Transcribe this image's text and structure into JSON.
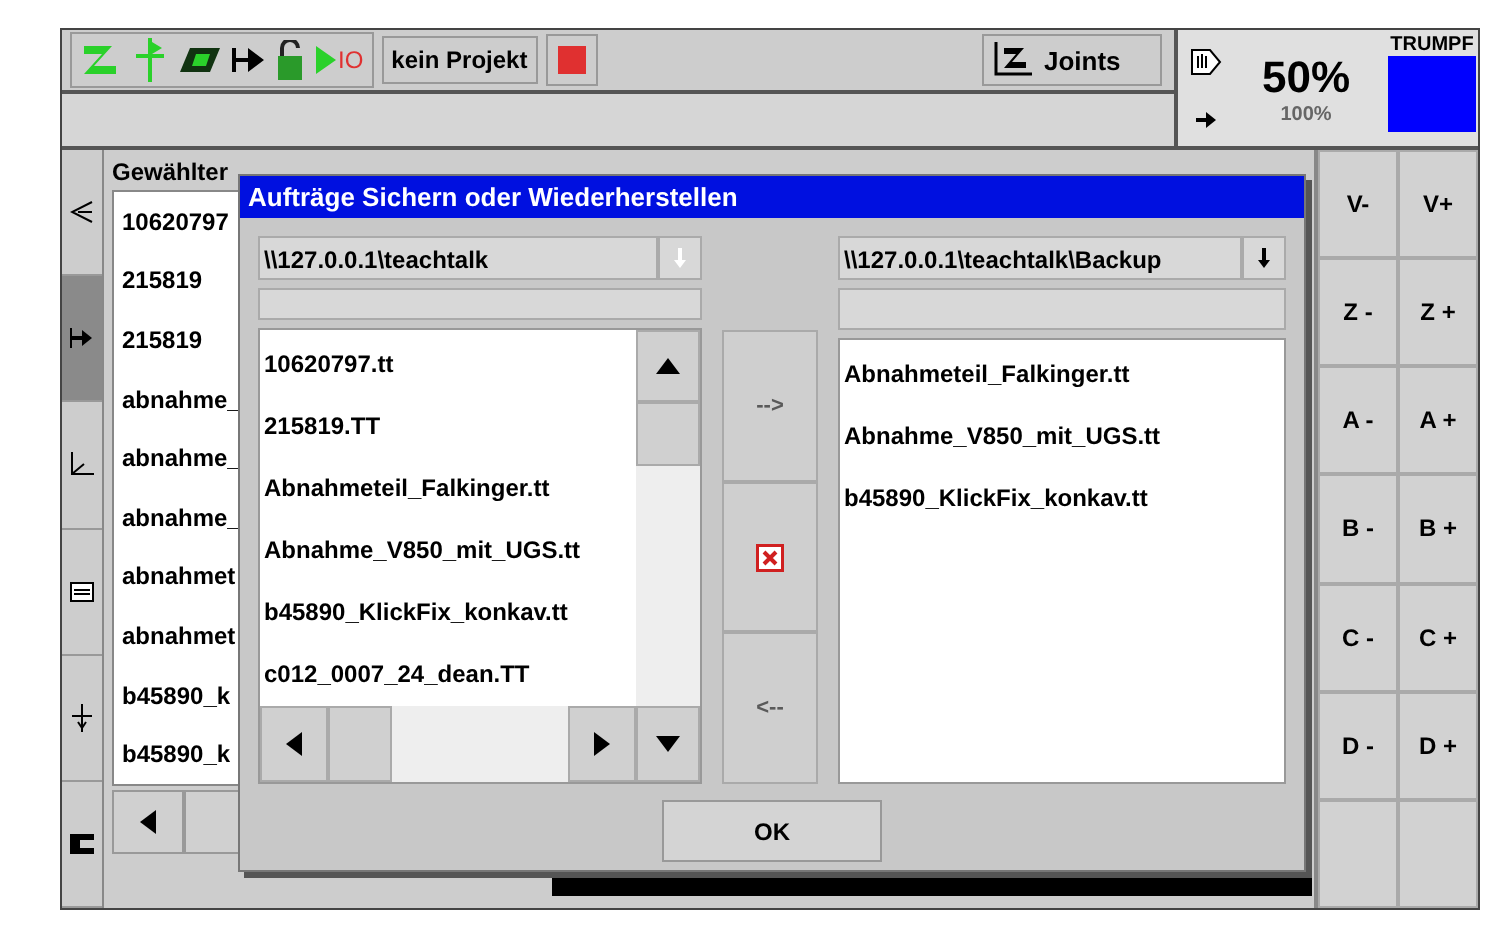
{
  "toolbar": {
    "io_label": "IO",
    "project": "kein Projekt",
    "mode": "Joints"
  },
  "status": {
    "override": "50%",
    "max_override": "100%",
    "brand": "TRUMPF"
  },
  "side_tabs": [
    {
      "selected": false
    },
    {
      "selected": true
    },
    {
      "selected": false
    },
    {
      "selected": false
    },
    {
      "selected": false
    },
    {
      "selected": false
    }
  ],
  "background": {
    "list_title": "Gewählter",
    "items": [
      "10620797",
      "215819",
      "215819",
      "abnahme_",
      "abnahme_",
      "abnahme_",
      "abnahmet",
      "abnahmet",
      "b45890_k",
      "b45890_k"
    ]
  },
  "jog_buttons": [
    {
      "minus": "V-",
      "plus": "V+"
    },
    {
      "minus": "Z -",
      "plus": "Z +"
    },
    {
      "minus": "A -",
      "plus": "A +"
    },
    {
      "minus": "B -",
      "plus": "B +"
    },
    {
      "minus": "C -",
      "plus": "C +"
    },
    {
      "minus": "D -",
      "plus": "D +"
    }
  ],
  "dialog": {
    "title": "Aufträge Sichern oder Wiederherstellen",
    "source": {
      "path": "\\\\127.0.0.1\\teachtalk",
      "files": [
        "10620797.tt",
        "215819.TT",
        "Abnahmeteil_Falkinger.tt",
        "Abnahme_V850_mit_UGS.tt",
        "b45890_KlickFix_konkav.tt",
        "c012_0007_24_dean.TT"
      ]
    },
    "target": {
      "path": "\\\\127.0.0.1\\teachtalk\\Backup",
      "files": [
        "Abnahmeteil_Falkinger.tt",
        "Abnahme_V850_mit_UGS.tt",
        "b45890_KlickFix_konkav.tt"
      ]
    },
    "actions": [
      {
        "kind": "transfer",
        "label": "-->",
        "disabled": true
      },
      {
        "kind": "delete",
        "disabled": false
      },
      {
        "kind": "transfer",
        "label": "<--",
        "disabled": true
      }
    ],
    "ok": "OK"
  }
}
